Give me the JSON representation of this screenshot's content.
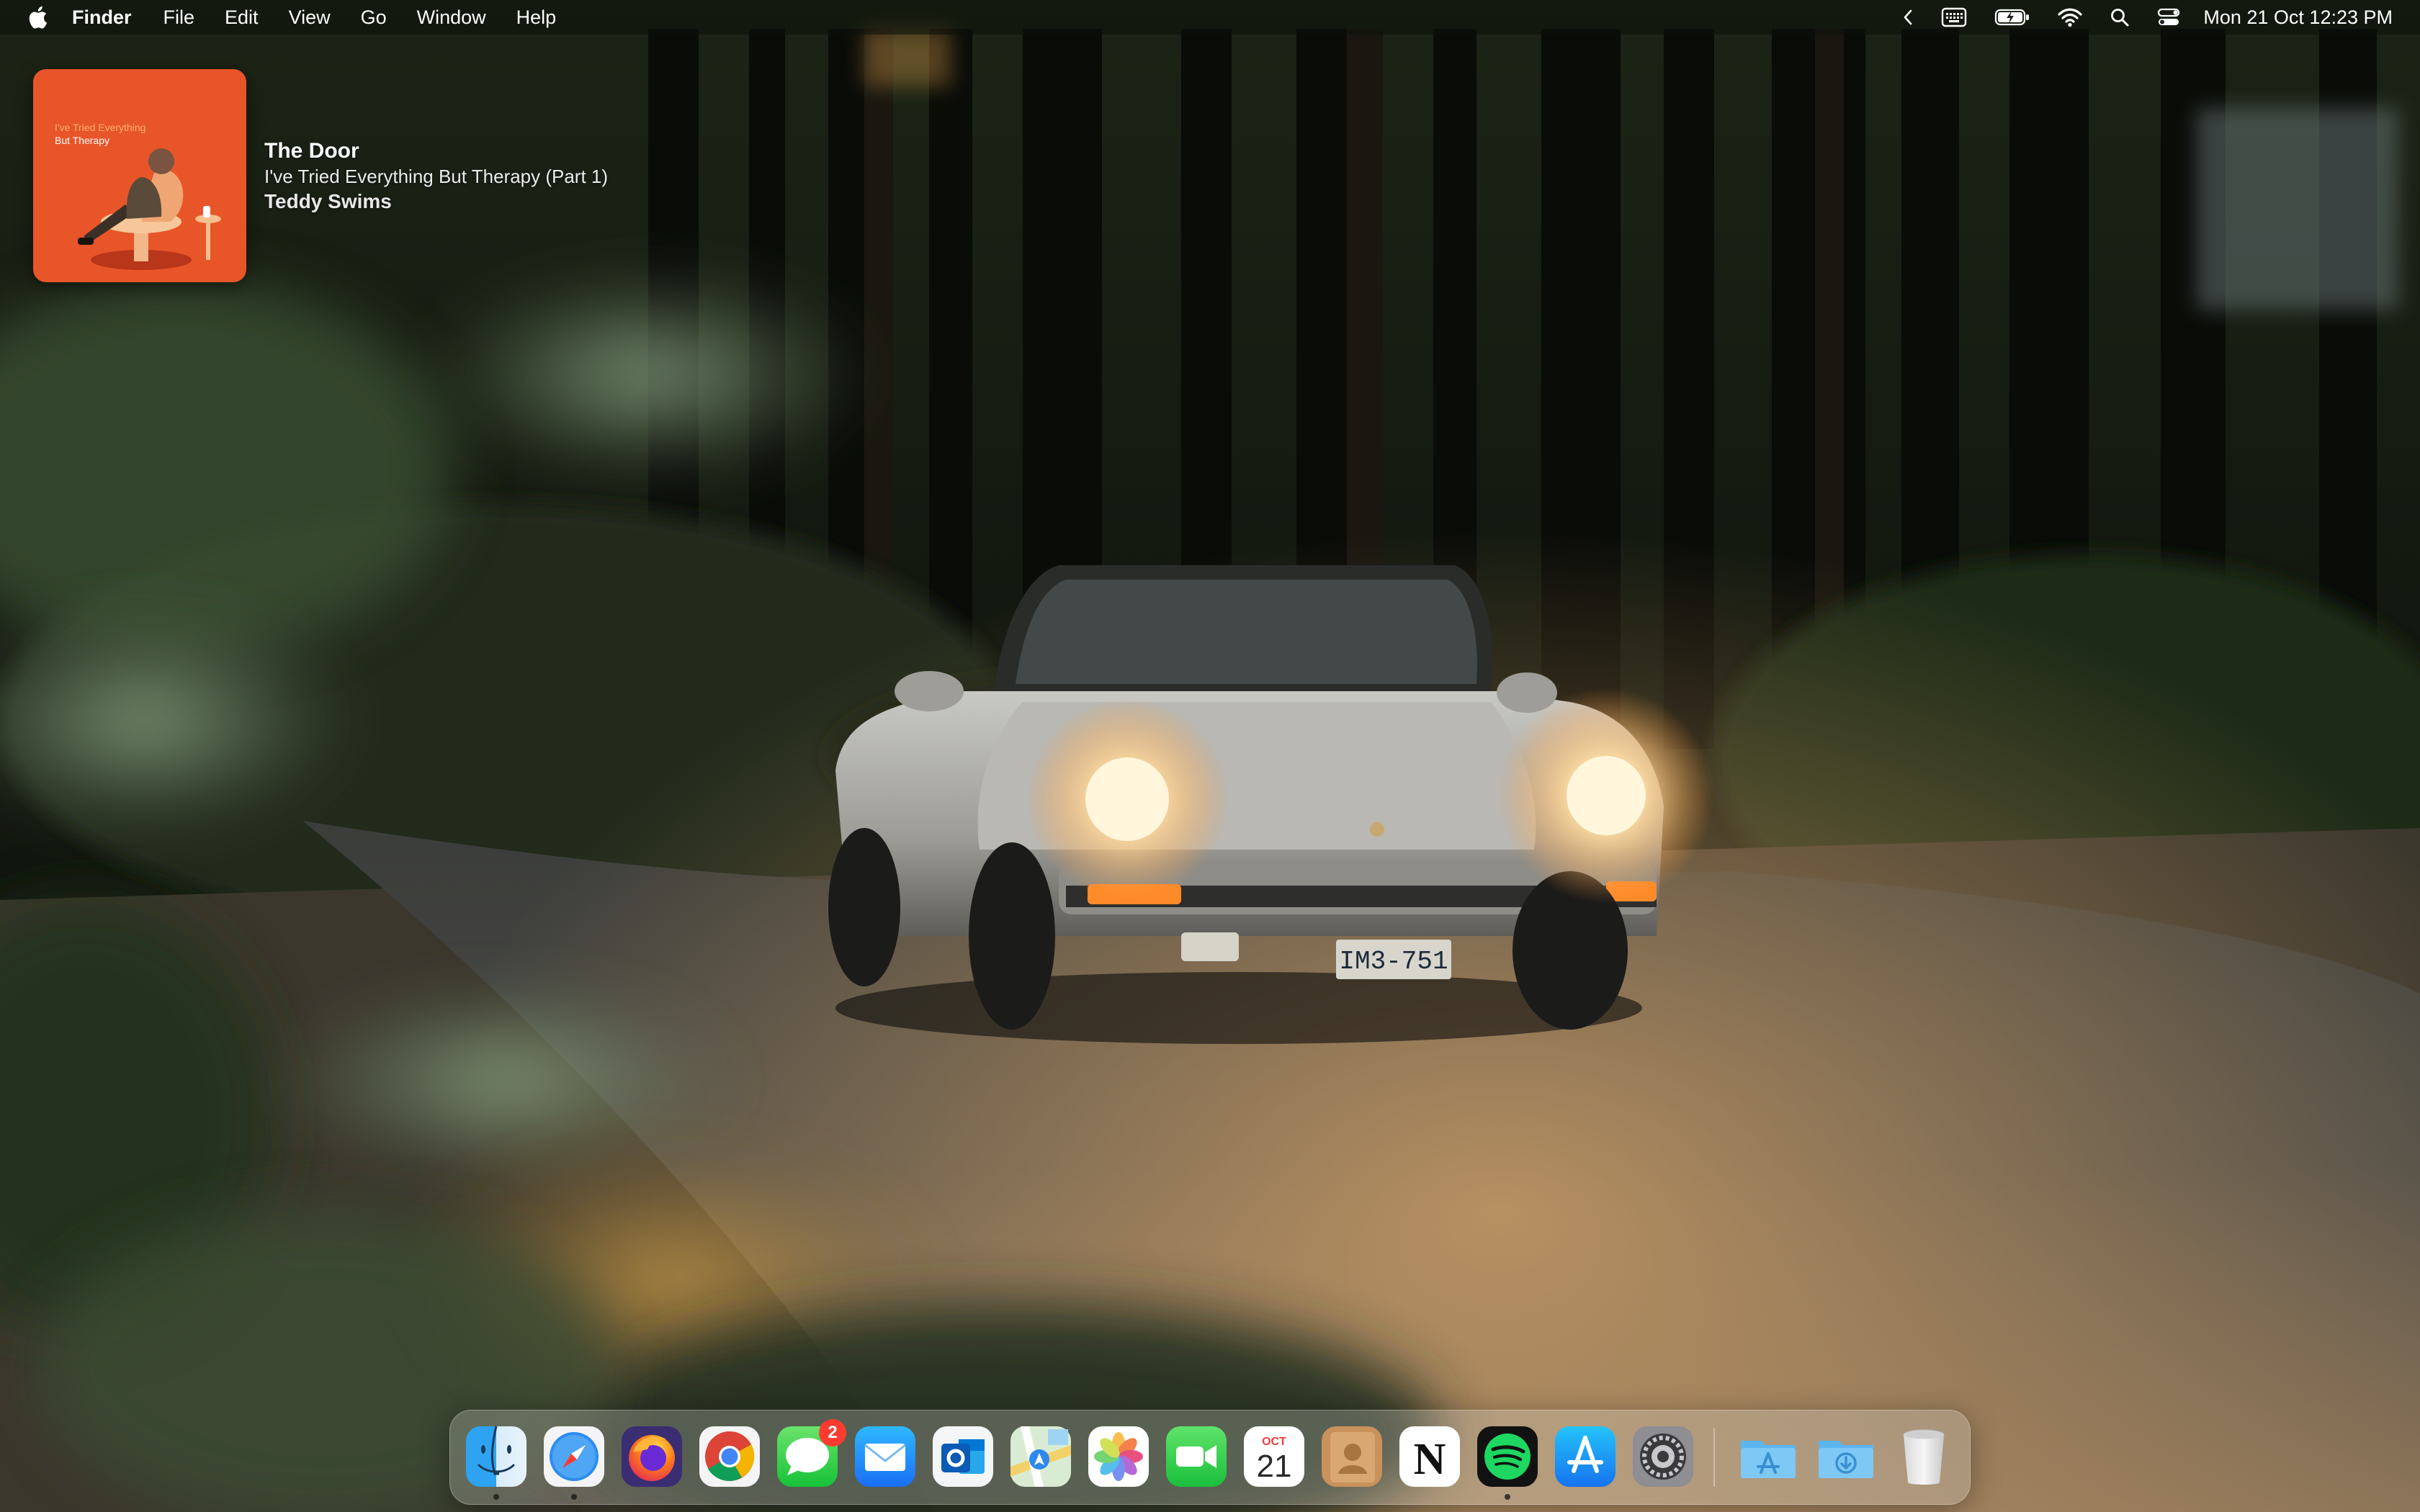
{
  "menubar": {
    "app_name": "Finder",
    "menus": [
      "File",
      "Edit",
      "View",
      "Go",
      "Window",
      "Help"
    ],
    "clock": "Mon 21 Oct  12:23 PM",
    "status_icons": [
      "chevron-left-icon",
      "keyboard-icon",
      "battery-icon",
      "wifi-icon",
      "search-icon",
      "control-center-icon"
    ]
  },
  "now_playing": {
    "title": "The Door",
    "album": "I've Tried Everything But Therapy (Part 1)",
    "artist": "Teddy Swims",
    "art_text_line1": "I've Tried Everything",
    "art_text_line2": "But Therapy",
    "art_color": "#e8492a"
  },
  "dock": {
    "apps": [
      {
        "name": "Finder",
        "icon": "finder-icon",
        "running": true
      },
      {
        "name": "Safari",
        "icon": "safari-icon",
        "running": true
      },
      {
        "name": "Firefox",
        "icon": "firefox-icon",
        "running": false
      },
      {
        "name": "Google Chrome",
        "icon": "chrome-icon",
        "running": false
      },
      {
        "name": "Messages",
        "icon": "messages-icon",
        "running": false,
        "badge": "2"
      },
      {
        "name": "Mail",
        "icon": "mail-icon",
        "running": false
      },
      {
        "name": "Microsoft Outlook",
        "icon": "outlook-icon",
        "running": false
      },
      {
        "name": "Maps",
        "icon": "maps-icon",
        "running": false
      },
      {
        "name": "Photos",
        "icon": "photos-icon",
        "running": false
      },
      {
        "name": "FaceTime",
        "icon": "facetime-icon",
        "running": false
      },
      {
        "name": "Calendar",
        "icon": "calendar-icon",
        "running": false,
        "month": "OCT",
        "day": "21"
      },
      {
        "name": "Contacts",
        "icon": "contacts-icon",
        "running": false
      },
      {
        "name": "Notion",
        "icon": "notion-icon",
        "running": false,
        "glyph": "N"
      },
      {
        "name": "Spotify",
        "icon": "spotify-icon",
        "running": true
      },
      {
        "name": "App Store",
        "icon": "app-store-icon",
        "running": false
      },
      {
        "name": "System Settings",
        "icon": "settings-icon",
        "running": false
      }
    ],
    "folders": [
      {
        "name": "Applications",
        "icon": "applications-folder-icon"
      },
      {
        "name": "Downloads",
        "icon": "downloads-folder-icon"
      }
    ],
    "trash": {
      "name": "Trash",
      "icon": "trash-icon"
    }
  },
  "wallpaper": {
    "plate_text": "IM3-751"
  }
}
